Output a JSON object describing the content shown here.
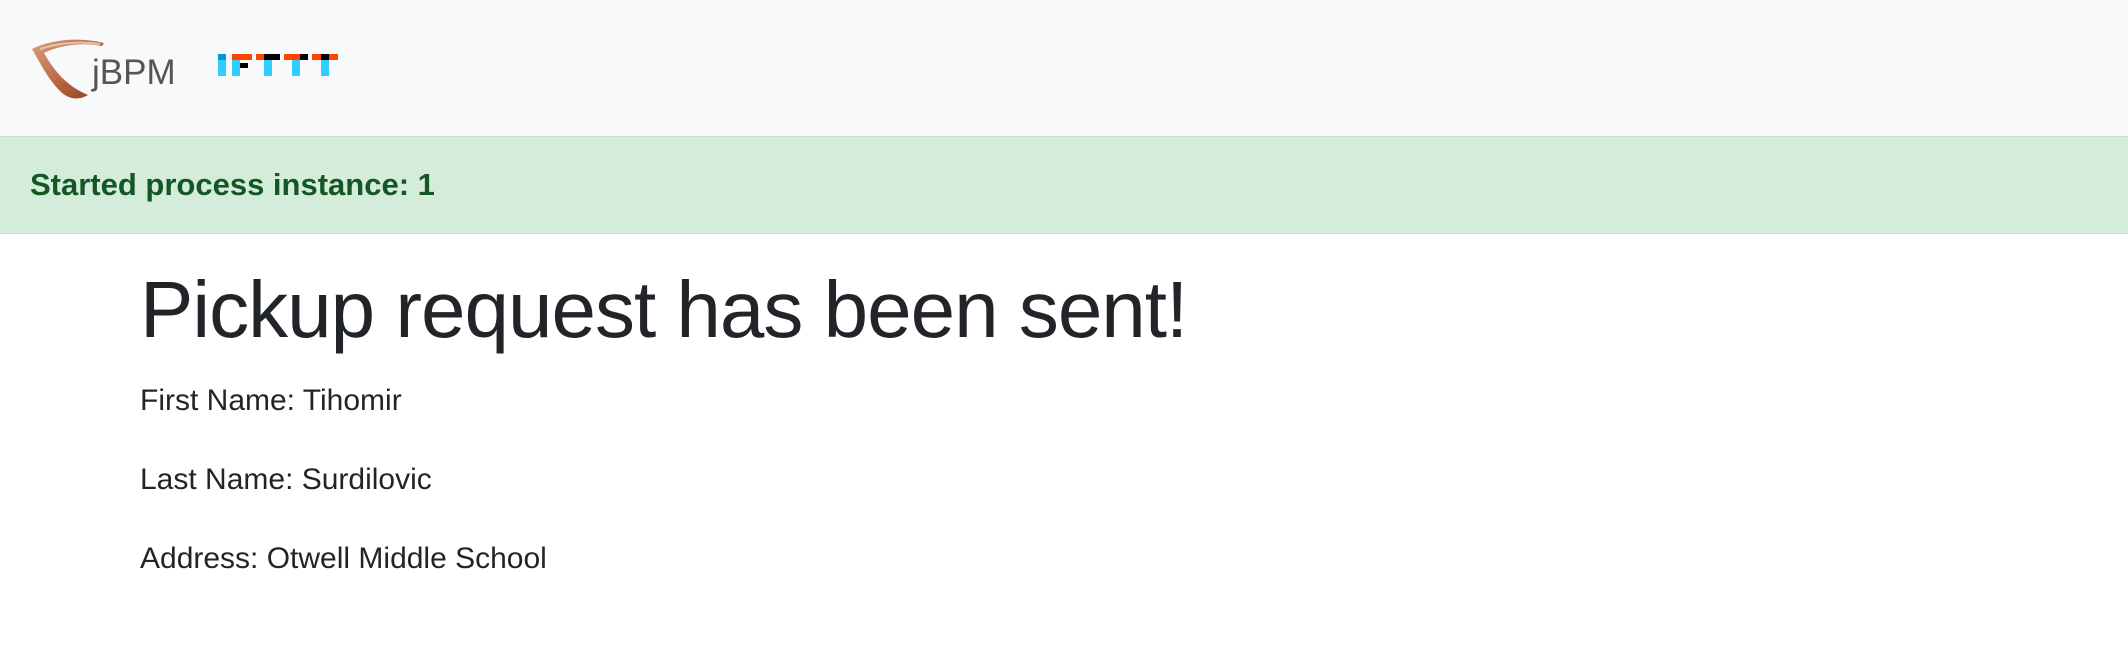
{
  "header": {
    "brand_text": "jBPM",
    "logo_jbpm": "jbpm-logo",
    "logo_ifttt": "ifttt-logo",
    "bg_color": "#f8f9fa"
  },
  "alert": {
    "message": "Started process instance: 1",
    "bg_color": "#d4edda",
    "text_color": "#155724"
  },
  "main": {
    "title": "Pickup request has been sent!",
    "fields": [
      "First Name: Tihomir",
      "Last Name: Surdilovic",
      "Address: Otwell Middle School"
    ]
  }
}
